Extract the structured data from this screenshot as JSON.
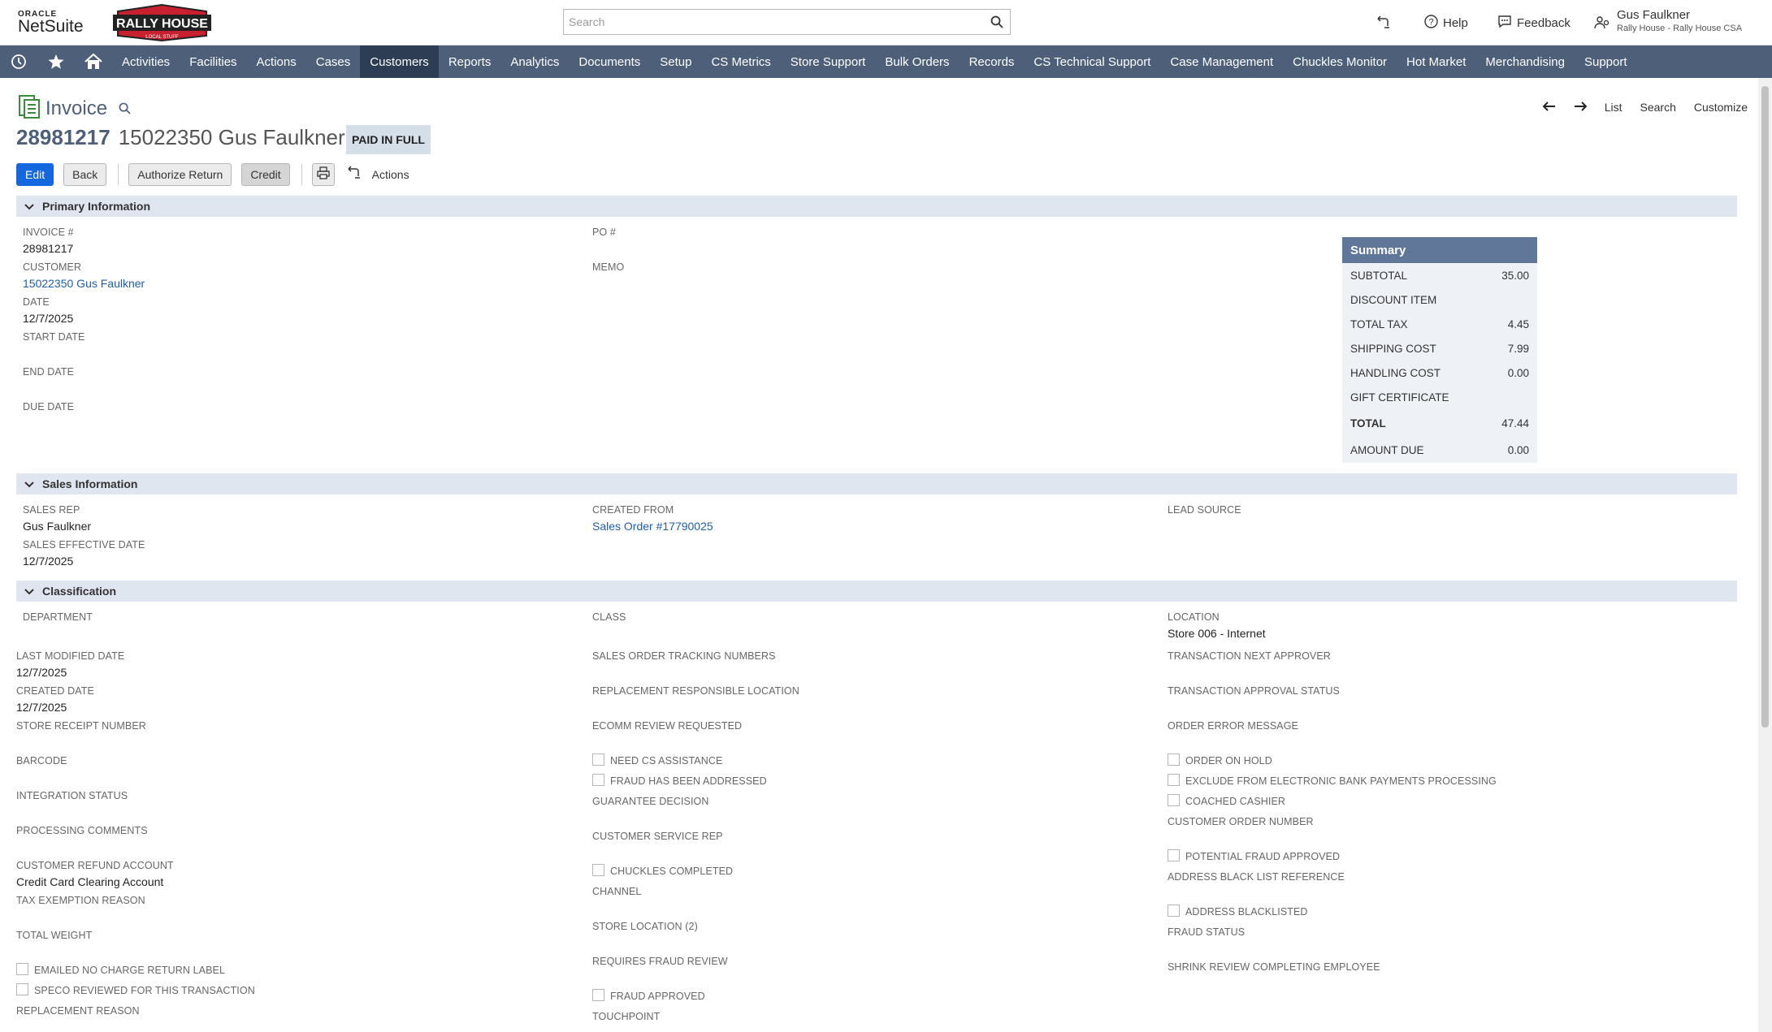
{
  "header": {
    "oracle_label": "ORACLE",
    "netsuite_label": "NetSuite",
    "brand_logo_line1": "RALLY HOUSE",
    "brand_logo_line2": "LOCAL STUFF",
    "search_placeholder": "Search",
    "help_label": "Help",
    "feedback_label": "Feedback",
    "user_name": "Gus Faulkner",
    "user_role": "Rally House - Rally House CSA"
  },
  "nav": {
    "items": [
      "Activities",
      "Facilities",
      "Actions",
      "Cases",
      "Customers",
      "Reports",
      "Analytics",
      "Documents",
      "Setup",
      "CS Metrics",
      "Store Support",
      "Bulk Orders",
      "Records",
      "CS Technical Support",
      "Case Management",
      "Chuckles Monitor",
      "Hot Market",
      "Merchandising",
      "Support"
    ],
    "active": "Customers"
  },
  "page": {
    "title": "Invoice",
    "record_number": "28981217",
    "record_name": "15022350 Gus Faulkner",
    "status": "PAID IN FULL",
    "links": {
      "list": "List",
      "search": "Search",
      "customize": "Customize"
    }
  },
  "buttons": {
    "edit": "Edit",
    "back": "Back",
    "authorize_return": "Authorize Return",
    "credit": "Credit",
    "actions": "Actions"
  },
  "primary": {
    "section_title": "Primary Information",
    "invoice_label": "INVOICE #",
    "invoice_value": "28981217",
    "customer_label": "CUSTOMER",
    "customer_value": "15022350 Gus Faulkner",
    "date_label": "DATE",
    "date_value": "12/7/2025",
    "start_date_label": "START DATE",
    "end_date_label": "END DATE",
    "due_date_label": "DUE DATE",
    "po_label": "PO #",
    "memo_label": "MEMO"
  },
  "summary": {
    "title": "Summary",
    "rows": [
      {
        "label": "SUBTOTAL",
        "value": "35.00"
      },
      {
        "label": "DISCOUNT ITEM",
        "value": ""
      },
      {
        "label": "TOTAL TAX",
        "value": "4.45"
      },
      {
        "label": "SHIPPING COST",
        "value": "7.99"
      },
      {
        "label": "HANDLING COST",
        "value": "0.00"
      },
      {
        "label": "GIFT CERTIFICATE",
        "value": ""
      },
      {
        "label": "TOTAL",
        "value": "47.44"
      },
      {
        "label": "AMOUNT DUE",
        "value": "0.00"
      }
    ]
  },
  "sales": {
    "section_title": "Sales Information",
    "sales_rep_label": "SALES REP",
    "sales_rep_value": "Gus Faulkner",
    "sales_effective_label": "SALES EFFECTIVE DATE",
    "sales_effective_value": "12/7/2025",
    "created_from_label": "CREATED FROM",
    "created_from_value": "Sales Order #17790025",
    "lead_source_label": "LEAD SOURCE"
  },
  "classification": {
    "section_title": "Classification",
    "department_label": "DEPARTMENT",
    "last_modified_label": "LAST MODIFIED DATE",
    "last_modified_value": "12/7/2025",
    "created_date_label": "CREATED DATE",
    "created_date_value": "12/7/2025",
    "store_receipt_label": "STORE RECEIPT NUMBER",
    "barcode_label": "BARCODE",
    "integration_label": "INTEGRATION STATUS",
    "processing_label": "PROCESSING COMMENTS",
    "refund_account_label": "CUSTOMER REFUND ACCOUNT",
    "refund_account_value": "Credit Card Clearing Account",
    "tax_exemption_label": "TAX EXEMPTION REASON",
    "total_weight_label": "TOTAL WEIGHT",
    "emailed_label": "EMAILED NO CHARGE RETURN LABEL",
    "speco_label": "SPECO REVIEWED FOR THIS TRANSACTION",
    "replacement_label": "REPLACEMENT REASON",
    "class_label": "CLASS",
    "so_tracking_label": "SALES ORDER TRACKING NUMBERS",
    "replacement_loc_label": "REPLACEMENT RESPONSIBLE LOCATION",
    "ecomm_label": "ECOMM REVIEW REQUESTED",
    "need_cs_label": "NEED CS ASSISTANCE",
    "fraud_addressed_label": "FRAUD HAS BEEN ADDRESSED",
    "guarantee_label": "GUARANTEE DECISION",
    "csr_label": "CUSTOMER SERVICE REP",
    "chuckles_label": "CHUCKLES COMPLETED",
    "channel_label": "CHANNEL",
    "store_location_label": "STORE LOCATION (2)",
    "requires_fraud_label": "REQUIRES FRAUD REVIEW",
    "fraud_approved_label": "FRAUD APPROVED",
    "touchpoint_label": "TOUCHPOINT",
    "location_label": "LOCATION",
    "location_value": "Store 006 - Internet",
    "next_approver_label": "TRANSACTION NEXT APPROVER",
    "approval_status_label": "TRANSACTION APPROVAL STATUS",
    "order_error_label": "ORDER ERROR MESSAGE",
    "order_on_hold_label": "ORDER ON HOLD",
    "exclude_label": "EXCLUDE FROM ELECTRONIC BANK PAYMENTS PROCESSING",
    "coached_label": "COACHED CASHIER",
    "cust_order_num_label": "CUSTOMER ORDER NUMBER",
    "potential_fraud_label": "POTENTIAL FRAUD APPROVED",
    "address_blacklist_ref_label": "ADDRESS BLACK LIST REFERENCE",
    "address_blacklisted_label": "ADDRESS BLACKLISTED",
    "fraud_status_label": "FRAUD STATUS",
    "shrink_label": "SHRINK REVIEW COMPLETING EMPLOYEE"
  },
  "colors": {
    "nav_bg": "#4d5f79",
    "nav_active": "#2d3d54",
    "section_bg": "#e0e6ef",
    "primary_button": "#1467de",
    "summary_header": "#607799",
    "link": "#1f5ea8"
  }
}
